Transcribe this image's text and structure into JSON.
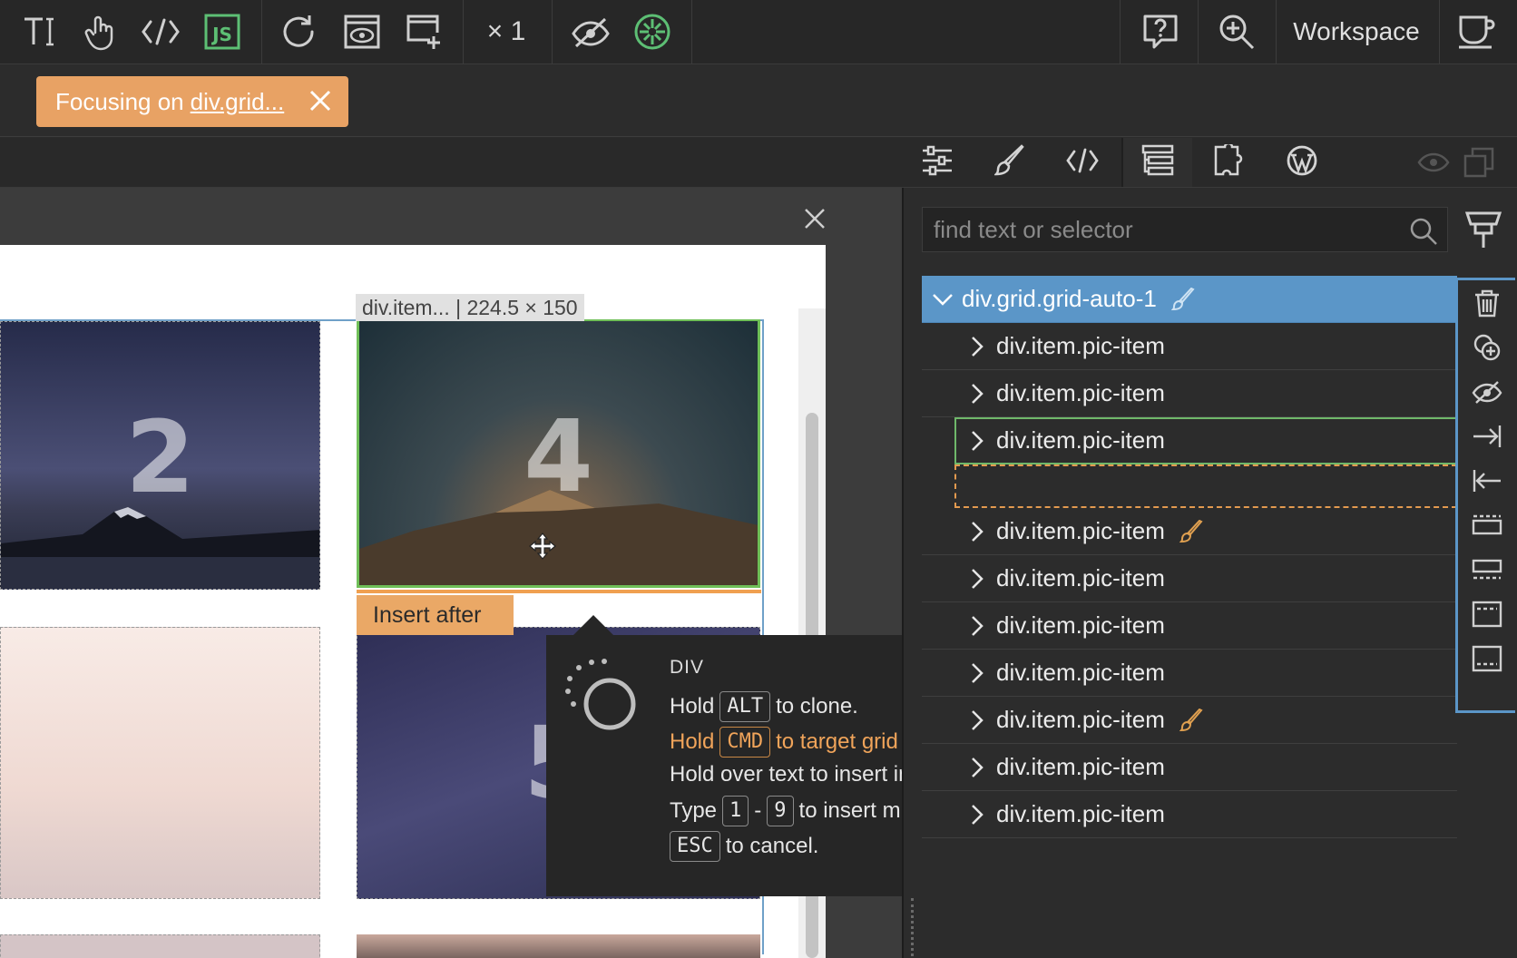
{
  "toolbar": {
    "zoom_label": "× 1",
    "workspace_label": "Workspace",
    "icons": [
      "text-tool-icon",
      "touch-icon",
      "code-icon",
      "js-icon",
      "refresh-icon",
      "preview-icon",
      "add-page-icon",
      "hide-icon",
      "target-icon",
      "help-icon",
      "zoom-in-icon",
      "cup-icon"
    ],
    "accent_green": "#5dbf74"
  },
  "focus": {
    "prefix": "Focusing on",
    "target": "div.grid..."
  },
  "canvas": {
    "selection_label": "div.item... | 224.5 × 150",
    "insert_after_label": "Insert after",
    "tiles": [
      {
        "number": "2"
      },
      {
        "number": "4"
      },
      {
        "number": "5"
      }
    ]
  },
  "tooltip": {
    "title": "DIV",
    "line1_pre": "Hold",
    "line1_key": "ALT",
    "line1_post": "to clone.",
    "line2_pre": "Hold",
    "line2_key": "CMD",
    "line2_post": "to target grid cells.",
    "line3": "Hold over text to insert into text.",
    "line4_pre": "Type",
    "line4_key1": "1",
    "line4_dash": "-",
    "line4_key2": "9",
    "line4_post": "to insert multiple copies.",
    "line5_key": "ESC",
    "line5_post": "to cancel."
  },
  "panel": {
    "search_placeholder": "find text or selector",
    "tree": {
      "root": "div.grid.grid-auto-1",
      "children": [
        "div.item.pic-item",
        "div.item.pic-item",
        "div.item.pic-item",
        "div.item.pic-item",
        "div.item.pic-item",
        "div.item.pic-item",
        "div.item.pic-item",
        "div.item.pic-item",
        "div.item.pic-item",
        "div.item.pic-item"
      ]
    }
  }
}
